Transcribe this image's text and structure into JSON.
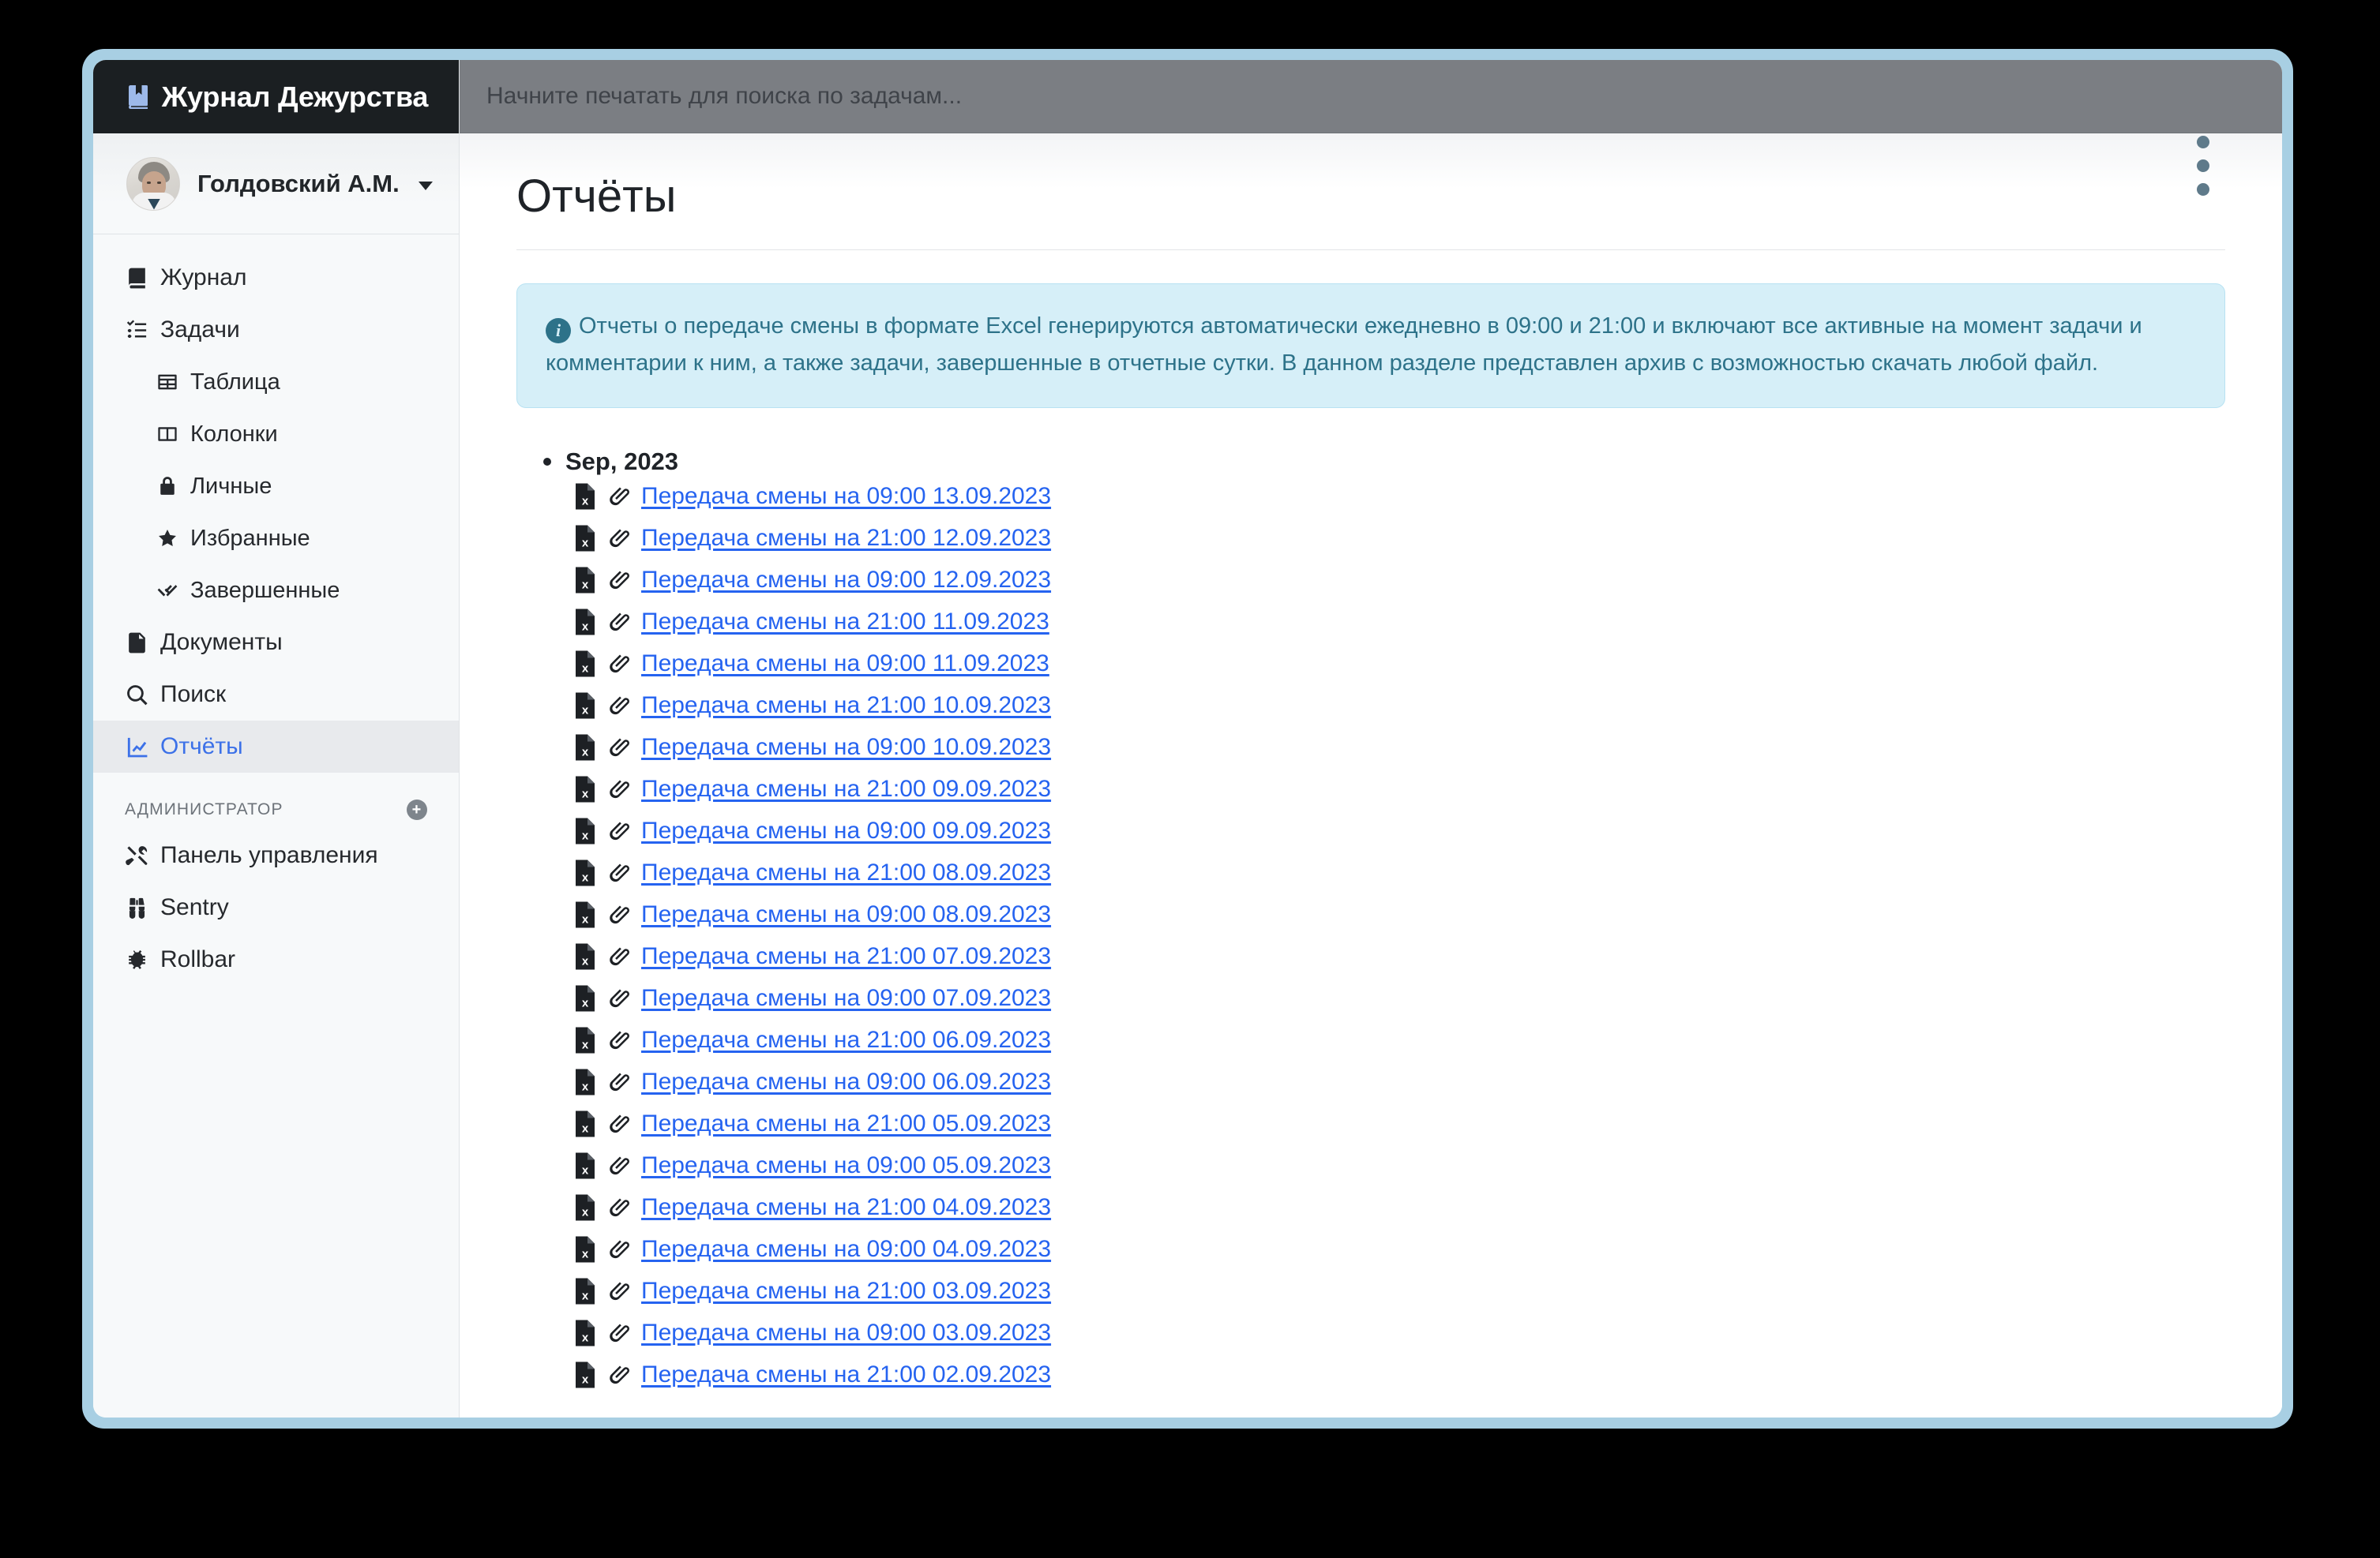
{
  "brand": {
    "title": "Журнал Дежурства",
    "icon": "book-bookmark-icon"
  },
  "user": {
    "name": "Голдовский А.М.",
    "avatar": "user-avatar",
    "caret": "chevron-down-icon"
  },
  "search": {
    "placeholder": "Начните печатать для поиска по задачам...",
    "value": ""
  },
  "sidebar": {
    "items": [
      {
        "label": "Журнал",
        "icon": "book-icon",
        "level": 0,
        "active": false
      },
      {
        "label": "Задачи",
        "icon": "checklist-icon",
        "level": 0,
        "active": false
      },
      {
        "label": "Таблица",
        "icon": "table-icon",
        "level": 1,
        "active": false
      },
      {
        "label": "Колонки",
        "icon": "columns-icon",
        "level": 1,
        "active": false
      },
      {
        "label": "Личные",
        "icon": "lock-icon",
        "level": 1,
        "active": false
      },
      {
        "label": "Избранные",
        "icon": "star-icon",
        "level": 1,
        "active": false
      },
      {
        "label": "Завершенные",
        "icon": "double-check-icon",
        "level": 1,
        "active": false
      },
      {
        "label": "Документы",
        "icon": "document-icon",
        "level": 0,
        "active": false
      },
      {
        "label": "Поиск",
        "icon": "search-icon",
        "level": 0,
        "active": false
      },
      {
        "label": "Отчёты",
        "icon": "chart-line-icon",
        "level": 0,
        "active": true
      }
    ],
    "admin_section": {
      "label": "АДМИНИСТРАТОР",
      "add_icon": "plus-circle-icon",
      "items": [
        {
          "label": "Панель управления",
          "icon": "tools-icon"
        },
        {
          "label": "Sentry",
          "icon": "binoculars-icon"
        },
        {
          "label": "Rollbar",
          "icon": "bug-icon"
        }
      ]
    }
  },
  "page": {
    "title": "Отчёты",
    "alert": {
      "icon": "info-circle-icon",
      "text": "Отчеты о передаче смены в формате Excel генерируются автоматически ежедневно в 09:00 и 21:00 и включают все активные на момент задачи и комментарии к ним, а также задачи, завершенные в отчетные сутки. В данном разделе представлен архив с возможностью скачать любой файл."
    }
  },
  "reports": {
    "month_group": "Sep, 2023",
    "file_icon": "excel-file-icon",
    "attach_icon": "paperclip-icon",
    "files": [
      "Передача смены на 09:00 13.09.2023",
      "Передача смены на 21:00 12.09.2023",
      "Передача смены на 09:00 12.09.2023",
      "Передача смены на 21:00 11.09.2023",
      "Передача смены на 09:00 11.09.2023",
      "Передача смены на 21:00 10.09.2023",
      "Передача смены на 09:00 10.09.2023",
      "Передача смены на 21:00 09.09.2023",
      "Передача смены на 09:00 09.09.2023",
      "Передача смены на 21:00 08.09.2023",
      "Передача смены на 09:00 08.09.2023",
      "Передача смены на 21:00 07.09.2023",
      "Передача смены на 09:00 07.09.2023",
      "Передача смены на 21:00 06.09.2023",
      "Передача смены на 09:00 06.09.2023",
      "Передача смены на 21:00 05.09.2023",
      "Передача смены на 09:00 05.09.2023",
      "Передача смены на 21:00 04.09.2023",
      "Передача смены на 09:00 04.09.2023",
      "Передача смены на 21:00 03.09.2023",
      "Передача смены на 09:00 03.09.2023",
      "Передача смены на 21:00 02.09.2023"
    ]
  },
  "colors": {
    "frame": "#a8cfe3",
    "brand_bar": "#1b1f22",
    "search_bar": "#7b7e83",
    "sidebar_bg": "#f7f9fa",
    "active_bg": "#e8eaed",
    "accent_blue": "#3c71e8",
    "link_blue": "#2563f0",
    "alert_bg": "#d6eff8",
    "alert_border": "#b8e2f2",
    "alert_text": "#2d7289"
  }
}
